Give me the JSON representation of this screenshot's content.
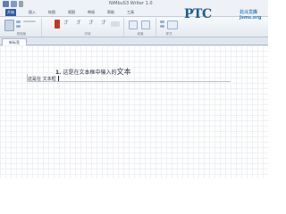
{
  "window": {
    "title": "NiMbuS3 Writer 1.0"
  },
  "ribbon": {
    "tabs": [
      {
        "label": "开始",
        "active": true
      },
      {
        "label": "插入"
      },
      {
        "label": "绘图"
      },
      {
        "label": "视图"
      },
      {
        "label": "审阅"
      },
      {
        "label": "帮助"
      },
      {
        "label": "工具"
      }
    ],
    "group_labels": [
      "剪贴板",
      "字体",
      "段落",
      "样式"
    ]
  },
  "watermark": {
    "brand": "PTC",
    "subtitle": "北斗文库",
    "url": "Jsms.org"
  },
  "page_tab": {
    "label": "新标签"
  },
  "document": {
    "heading_number": "1.",
    "heading_text": "这是在文本框中输入的",
    "heading_tail": "文本",
    "ink_line_text": "这是在 文本框"
  },
  "colors": {
    "accent": "#2a5aa0",
    "watermark": "#1f5d8c"
  }
}
